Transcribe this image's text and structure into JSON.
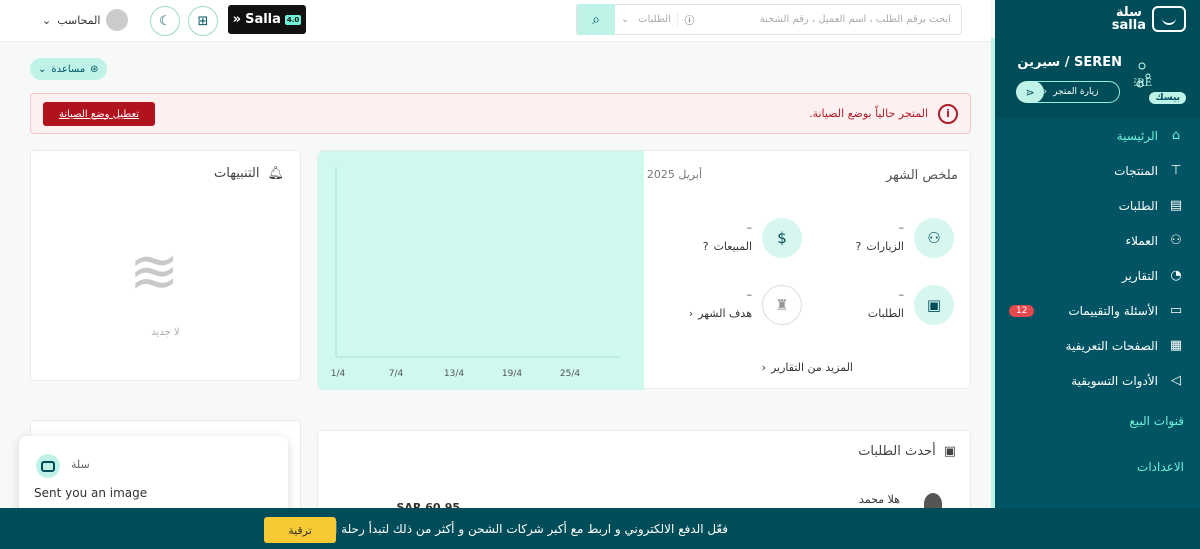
{
  "sidebar": {
    "logo": "سلة salla",
    "logo_ar": "سلة",
    "logo_en": "salla",
    "store_name": "SEREN / سيرين",
    "store_avatar_text": "SERE",
    "plan": "بيسك",
    "visit_store": "زيارة المتجر",
    "items": [
      {
        "label": "الرئيسية",
        "icon": "home-icon"
      },
      {
        "label": "المنتجات",
        "icon": "shirt-icon"
      },
      {
        "label": "الطلبات",
        "icon": "orders-icon"
      },
      {
        "label": "العملاء",
        "icon": "users-icon"
      },
      {
        "label": "التقارير",
        "icon": "pie-chart-icon"
      },
      {
        "label": "الأسئلة والتقييمات",
        "icon": "comment-icon",
        "badge": "12"
      },
      {
        "label": "الصفحات التعريفية",
        "icon": "page-icon"
      },
      {
        "label": "الأدوات التسويقية",
        "icon": "megaphone-icon"
      }
    ],
    "section_channels": "قنوات البيع",
    "section_settings": "الاعدادات"
  },
  "topbar": {
    "search_placeholder": "ابحث برقم الطلب ، اسم العميل ، رقم الشحنة",
    "search_scope": "الطلبات",
    "user": "المحاسب",
    "salla_logo": "Salla"
  },
  "help": "مساعدة",
  "alert": {
    "text": "المتجر حالياً بوضع الصيانة.",
    "button": "تعطيل وضع الصيانة"
  },
  "summary": {
    "title": "ملخص الشهر",
    "month": "أبريل 2025",
    "visits": {
      "label": "الزيارات",
      "value": "–"
    },
    "sales": {
      "label": "المبيعات",
      "value": "–"
    },
    "orders": {
      "label": "الطلبات",
      "value": "–"
    },
    "goal": {
      "label": "هدف الشهر",
      "value": "–"
    },
    "more": "المزيد من التقارير"
  },
  "chart_data": {
    "type": "line",
    "categories": [
      "1/4",
      "7/4",
      "13/4",
      "19/4",
      "25/4"
    ],
    "series": [],
    "title": "",
    "xlabel": "",
    "ylabel": ""
  },
  "notifications": {
    "title": "التنبيهات",
    "empty": "لا جديد"
  },
  "orders": {
    "title": "أحدث الطلبات",
    "row_name": "هلا محمد",
    "row_price": "SAR 60.95"
  },
  "chat": {
    "sender": "سلة",
    "message": "Sent you an image"
  },
  "banner": {
    "text": "فعّل الدفع الالكتروني و اربط مع أكبر شركات الشحن و أكثر من ذلك لتبدأ رحلة أرباحك",
    "button": "ترقية"
  },
  "colors": {
    "primary": "#004d5a",
    "accent": "#bff3e8",
    "danger": "#b0121e",
    "highlight": "#6ff0d8"
  }
}
